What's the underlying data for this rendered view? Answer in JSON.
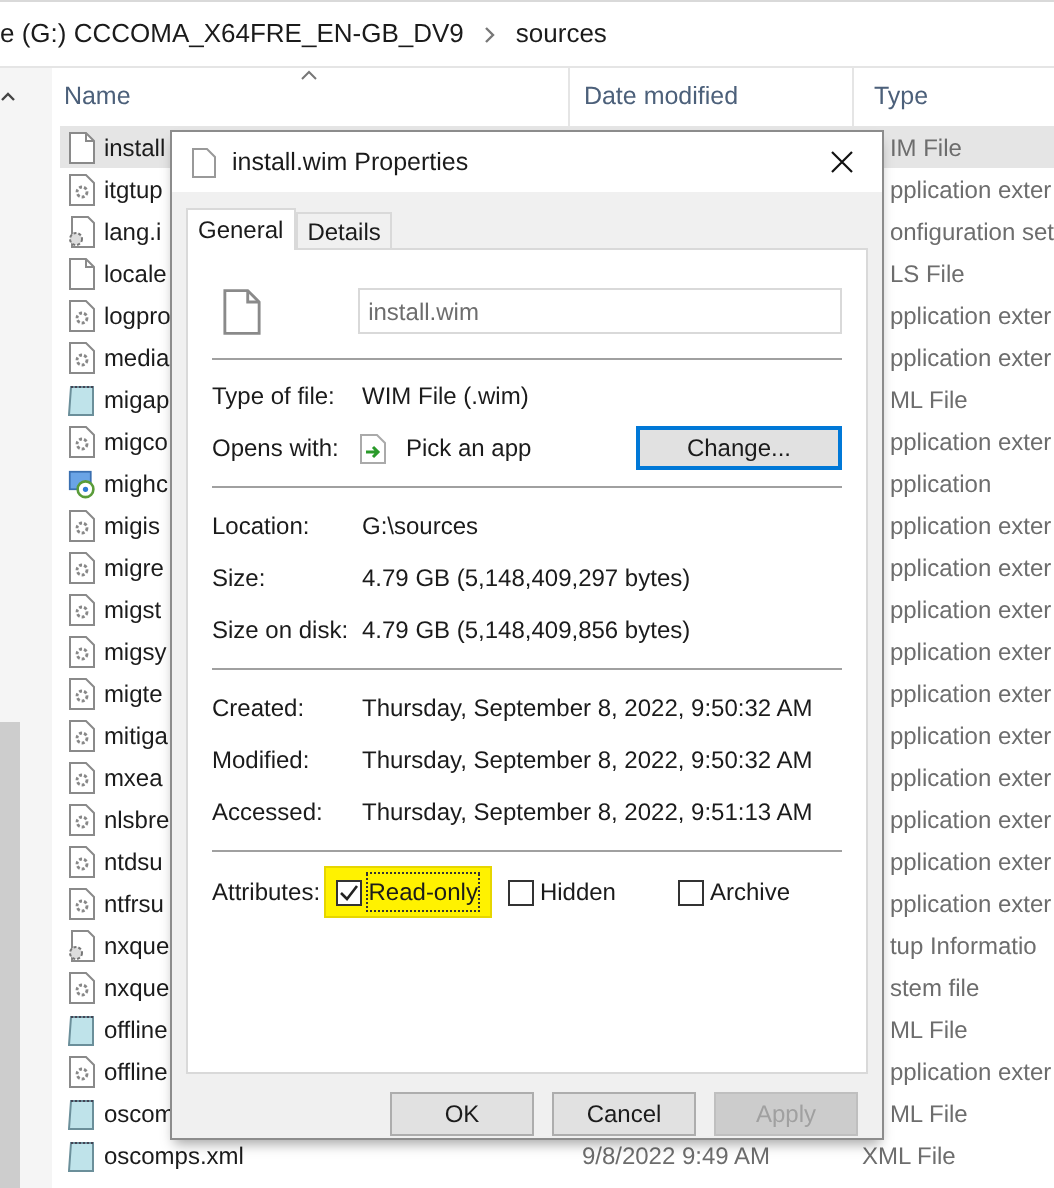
{
  "address_bar": {
    "path": [
      {
        "label": "e (G:) CCCOMA_X64FRE_EN-GB_DV9"
      },
      {
        "label": "sources"
      }
    ]
  },
  "file_list": {
    "columns": [
      {
        "label": "Name"
      },
      {
        "label": "Date modified"
      },
      {
        "label": "Type"
      }
    ],
    "rows": [
      {
        "name": "install",
        "type": "IM File",
        "kind": "blank",
        "selected": true
      },
      {
        "name": "itgtup",
        "type": "pplication exter",
        "kind": "dll",
        "selected": false
      },
      {
        "name": "lang.i",
        "type": "onfiguration set",
        "kind": "config",
        "selected": false
      },
      {
        "name": "locale",
        "type": "LS File",
        "kind": "blank",
        "selected": false
      },
      {
        "name": "logpro",
        "type": "pplication exter",
        "kind": "dll",
        "selected": false
      },
      {
        "name": "media",
        "type": "pplication exter",
        "kind": "dll",
        "selected": false
      },
      {
        "name": "migap",
        "type": "ML File",
        "kind": "xml",
        "selected": false
      },
      {
        "name": "migco",
        "type": "pplication exter",
        "kind": "dll",
        "selected": false
      },
      {
        "name": "mighc",
        "type": "pplication",
        "kind": "exe",
        "selected": false
      },
      {
        "name": "migis",
        "type": "pplication exter",
        "kind": "dll",
        "selected": false
      },
      {
        "name": "migre",
        "type": "pplication exter",
        "kind": "dll",
        "selected": false
      },
      {
        "name": "migst",
        "type": "pplication exter",
        "kind": "dll",
        "selected": false
      },
      {
        "name": "migsy",
        "type": "pplication exter",
        "kind": "dll",
        "selected": false
      },
      {
        "name": "migte",
        "type": "pplication exter",
        "kind": "dll",
        "selected": false
      },
      {
        "name": "mitiga",
        "type": "pplication exter",
        "kind": "dll",
        "selected": false
      },
      {
        "name": "mxea",
        "type": "pplication exter",
        "kind": "dll",
        "selected": false
      },
      {
        "name": "nlsbre",
        "type": "pplication exter",
        "kind": "dll",
        "selected": false
      },
      {
        "name": "ntdsu",
        "type": "pplication exter",
        "kind": "dll",
        "selected": false
      },
      {
        "name": "ntfrsu",
        "type": "pplication exter",
        "kind": "dll",
        "selected": false
      },
      {
        "name": "nxque",
        "type": "tup Informatio",
        "kind": "config",
        "selected": false
      },
      {
        "name": "nxque",
        "type": "stem file",
        "kind": "dll",
        "selected": false
      },
      {
        "name": "offline",
        "type": "ML File",
        "kind": "xml",
        "selected": false
      },
      {
        "name": "offline",
        "type": "pplication exter",
        "kind": "dll",
        "selected": false
      },
      {
        "name": "oscom",
        "type": "ML File",
        "kind": "xml",
        "selected": false
      },
      {
        "name": "oscomps.xml",
        "date": "9/8/2022 9:49 AM",
        "type": "XML File",
        "kind": "xml",
        "selected": false
      }
    ]
  },
  "dialog": {
    "title": "install.wim Properties",
    "tabs": [
      {
        "label": "General",
        "selected": true
      },
      {
        "label": "Details",
        "selected": false
      }
    ],
    "name_field": {
      "value": "install.wim"
    },
    "sections": [
      [
        {
          "kind": "text",
          "label": "Type of file:",
          "value": "WIM File (.wim)"
        },
        {
          "kind": "app",
          "label": "Opens with:",
          "value": "Pick an app",
          "button": "Change..."
        }
      ],
      [
        {
          "kind": "text",
          "label": "Location:",
          "value": "G:\\sources"
        },
        {
          "kind": "text",
          "label": "Size:",
          "value": "4.79 GB (5,148,409,297 bytes)"
        },
        {
          "kind": "text",
          "label": "Size on disk:",
          "value": "4.79 GB (5,148,409,856 bytes)"
        }
      ],
      [
        {
          "kind": "text",
          "label": "Created:",
          "value": "Thursday, September 8, 2022, 9:50:32 AM"
        },
        {
          "kind": "text",
          "label": "Modified:",
          "value": "Thursday, September 8, 2022, 9:50:32 AM"
        },
        {
          "kind": "text",
          "label": "Accessed:",
          "value": "Thursday, September 8, 2022, 9:51:13 AM"
        }
      ]
    ],
    "attributes": {
      "label": "Attributes:",
      "options": [
        {
          "label": "Read-only",
          "checked": true,
          "highlighted": true
        },
        {
          "label": "Hidden",
          "checked": false,
          "highlighted": false
        },
        {
          "label": "Archive",
          "checked": false,
          "highlighted": false
        }
      ]
    },
    "buttons": [
      {
        "label": "OK",
        "disabled": false
      },
      {
        "label": "Cancel",
        "disabled": false
      },
      {
        "label": "Apply",
        "disabled": true
      }
    ]
  }
}
